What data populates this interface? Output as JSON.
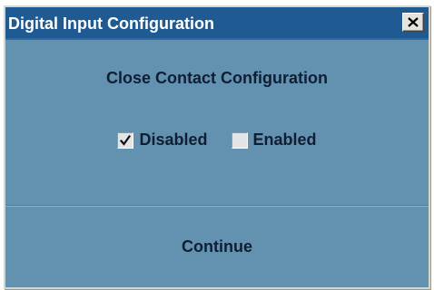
{
  "window": {
    "title": "Digital Input Configuration",
    "close_icon": "close-x-icon"
  },
  "dialog": {
    "heading": "Close Contact Configuration",
    "options": [
      {
        "label": "Disabled",
        "checked": true
      },
      {
        "label": "Enabled",
        "checked": false
      }
    ],
    "continue_label": "Continue"
  },
  "colors": {
    "titlebar": "#1f5a92",
    "body": "#6391b0",
    "text": "#0e1e33"
  }
}
